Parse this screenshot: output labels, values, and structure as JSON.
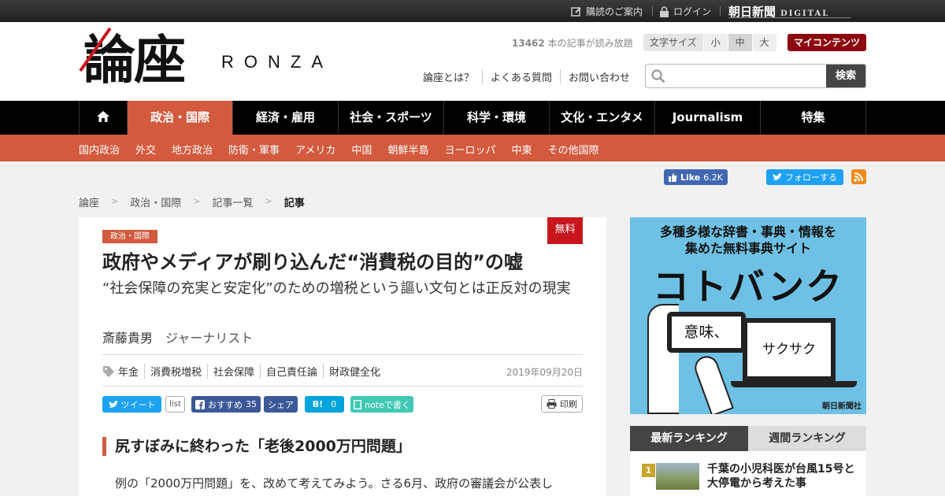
{
  "topbar": {
    "subscribe": "購読のご案内",
    "login": "ログイン",
    "brand": "朝日新聞",
    "brand_sub": "DIGITAL"
  },
  "header": {
    "logo": "論座",
    "logo_en": "RONZA",
    "read_count": "13462",
    "read_suffix": " 本の記事が読み放題",
    "font_size_label": "文字サイズ",
    "font_sizes": [
      "小",
      "中",
      "大"
    ],
    "font_size_selected": "中",
    "my_contents": "マイコンテンツ",
    "links": [
      "論座とは？",
      "よくある質問",
      "お問い合わせ"
    ],
    "search_placeholder": "",
    "search_button": "検索"
  },
  "nav": {
    "items": [
      "政治・国際",
      "経済・雇用",
      "社会・スポーツ",
      "科学・環境",
      "文化・エンタメ",
      "Journalism",
      "特集"
    ],
    "active": "政治・国際"
  },
  "subnav": [
    "国内政治",
    "外交",
    "地方政治",
    "防衛・軍事",
    "アメリカ",
    "中国",
    "朝鮮半島",
    "ヨーロッパ",
    "中東",
    "その他国際"
  ],
  "social": {
    "fb_like": "Like",
    "fb_count": "6.2K",
    "tw_follow": "フォローする"
  },
  "breadcrumb": [
    "論座",
    "政治・国際",
    "記事一覧",
    "記事"
  ],
  "article": {
    "category": "政治・国際",
    "badge": "無料",
    "title": "政府やメディアが刷り込んだ“消費税の目的”の嘘",
    "subtitle": "“社会保障の充実と安定化”のための増税という謳い文句とは正反対の現実",
    "author": "斎藤貴男",
    "author_role": "ジャーナリスト",
    "tags": [
      "年金",
      "消費税増税",
      "社会保障",
      "自己責任論",
      "財政健全化"
    ],
    "date": "2019年09月20日",
    "share": {
      "tweet": "ツイート",
      "list": "list",
      "fb_recommend": "おすすめ",
      "fb_count": "35",
      "fb_share": "シェア",
      "hatena": "B!",
      "hatena_count": "0",
      "note": "noteで書く",
      "print": "印刷"
    },
    "heading": "尻すぼみに終わった「老後2000万円問題」",
    "body_first": "例の「2000万円問題」を、改めて考えてみよう。さる6月、政府の審議会が公表し"
  },
  "ad": {
    "line1": "多種多様な辞書・事典・情報を",
    "line2": "集めた無料事典サイト",
    "brand": "コトバンク",
    "screen1": "意味、",
    "screen2": "サクサク",
    "footer": "朝日新聞社"
  },
  "ranking": {
    "tabs": [
      "最新ランキング",
      "週間ランキング"
    ],
    "items": [
      {
        "rank": "1",
        "title": "千葉の小児科医が台風15号と大停電から考えた事"
      }
    ]
  },
  "colors": {
    "accent": "#d35a3e",
    "brand_red": "#c8161d",
    "mycontents": "#8c0a0f",
    "twitter": "#1da1f2",
    "facebook": "#3b5998"
  }
}
